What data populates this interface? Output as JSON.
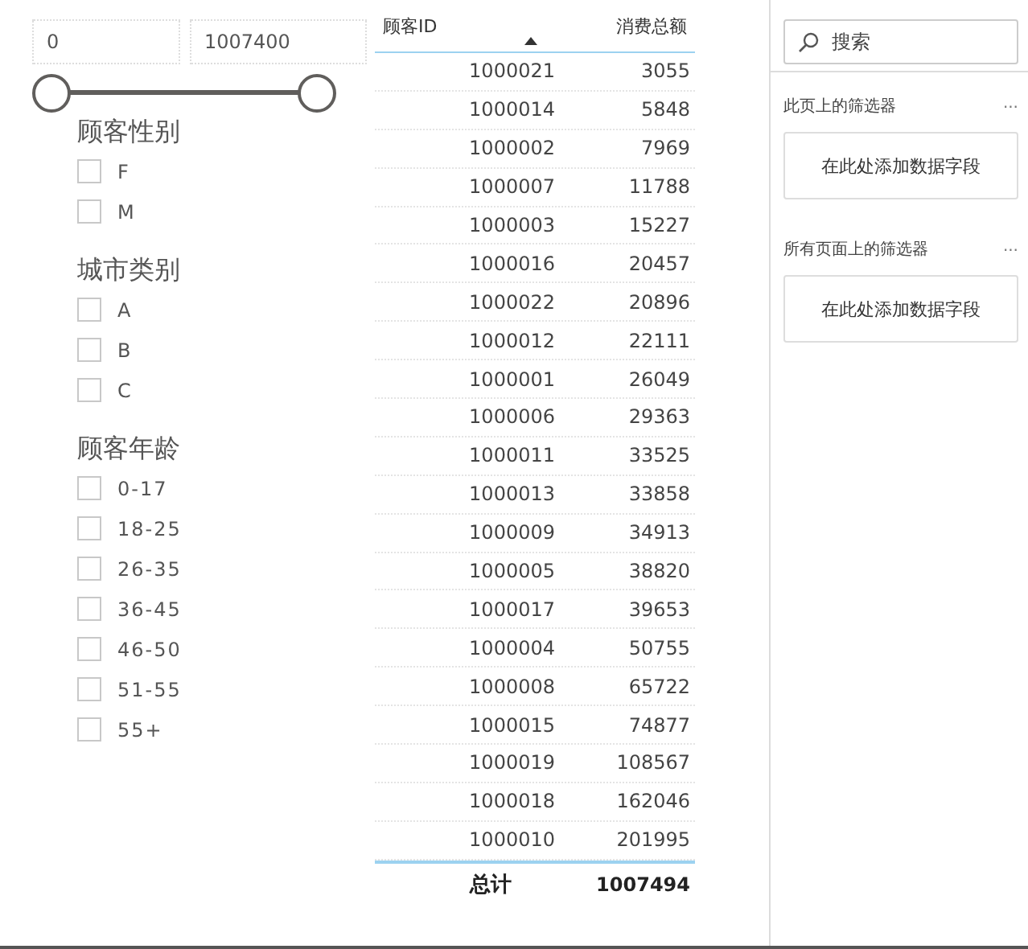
{
  "range_slicer": {
    "min_value": "0",
    "max_value": "1007400",
    "low_thumb": {
      "level": 0
    },
    "high_thumb": {
      "level": 1
    }
  },
  "slicers": [
    {
      "title": "顾客性别",
      "options": [
        {
          "label": "F",
          "checked": false
        },
        {
          "label": "M",
          "checked": false
        }
      ]
    },
    {
      "title": "城市类别",
      "options": [
        {
          "label": "A",
          "checked": false
        },
        {
          "label": "B",
          "checked": false
        },
        {
          "label": "C",
          "checked": false
        }
      ]
    },
    {
      "title": "顾客年龄",
      "options": [
        {
          "label": "0-17",
          "checked": false
        },
        {
          "label": "18-25",
          "checked": false
        },
        {
          "label": "26-35",
          "checked": false
        },
        {
          "label": "36-45",
          "checked": false
        },
        {
          "label": "46-50",
          "checked": false
        },
        {
          "label": "51-55",
          "checked": false
        },
        {
          "label": "55+",
          "checked": false
        }
      ]
    }
  ],
  "table": {
    "columns": [
      {
        "label": "顾客ID",
        "sorted": true
      },
      {
        "label": "消费总额",
        "sorted": false
      }
    ],
    "rows": [
      [
        "1000021",
        "3055"
      ],
      [
        "1000014",
        "5848"
      ],
      [
        "1000002",
        "7969"
      ],
      [
        "1000007",
        "11788"
      ],
      [
        "1000003",
        "15227"
      ],
      [
        "1000016",
        "20457"
      ],
      [
        "1000022",
        "20896"
      ],
      [
        "1000012",
        "22111"
      ],
      [
        "1000001",
        "26049"
      ],
      [
        "1000006",
        "29363"
      ],
      [
        "1000011",
        "33525"
      ],
      [
        "1000013",
        "33858"
      ],
      [
        "1000009",
        "34913"
      ],
      [
        "1000005",
        "38820"
      ],
      [
        "1000017",
        "39653"
      ],
      [
        "1000004",
        "50755"
      ],
      [
        "1000008",
        "65722"
      ],
      [
        "1000015",
        "74877"
      ],
      [
        "1000019",
        "108567"
      ],
      [
        "1000018",
        "162046"
      ],
      [
        "1000010",
        "201995"
      ]
    ],
    "total": {
      "label": "总计",
      "value": "1007494"
    }
  },
  "filters_pane": {
    "search": {
      "placeholder": "搜索"
    },
    "sections": [
      {
        "title": "此页上的筛选器",
        "more": "...",
        "drop_zone": "在此处添加数据字段"
      },
      {
        "title": "所有页面上的筛选器",
        "more": "...",
        "drop_zone": "在此处添加数据字段"
      }
    ]
  }
}
